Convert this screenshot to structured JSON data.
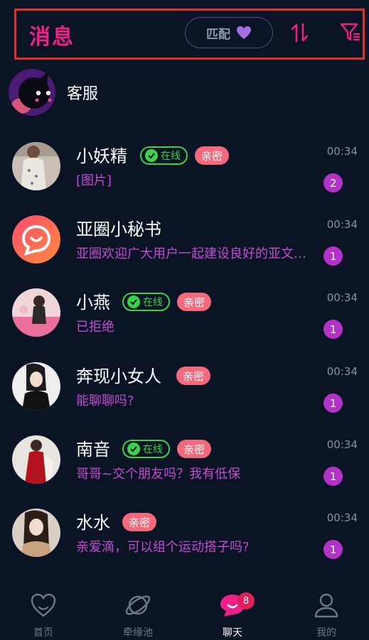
{
  "header": {
    "title": "消息",
    "match_label": "匹配"
  },
  "service": {
    "name": "客服"
  },
  "conversations": [
    {
      "name": "小妖精",
      "online": true,
      "online_label": "在线",
      "intimate_label": "亲密",
      "preview": "[图片]",
      "time": "00:34",
      "unread": "2"
    },
    {
      "name": "亚圈小秘书",
      "online": false,
      "online_label": "",
      "intimate_label": "",
      "preview": "亚圈欢迎广大用户一起建设良好的亚文…",
      "time": "00:34",
      "unread": "1"
    },
    {
      "name": "小燕",
      "online": true,
      "online_label": "在线",
      "intimate_label": "亲密",
      "preview": "已拒绝",
      "time": "00:34",
      "unread": "1"
    },
    {
      "name": "奔现小女人",
      "online": false,
      "online_label": "",
      "intimate_label": "亲密",
      "preview": "能聊聊吗?",
      "time": "00:34",
      "unread": "1"
    },
    {
      "name": "南音",
      "online": true,
      "online_label": "在线",
      "intimate_label": "亲密",
      "preview": "哥哥~交个朋友吗？我有低保",
      "time": "00:34",
      "unread": "1"
    },
    {
      "name": "水水",
      "online": false,
      "online_label": "",
      "intimate_label": "亲密",
      "preview": "亲爱滴，可以组个运动搭子吗?",
      "time": "00:34",
      "unread": "1"
    }
  ],
  "nav": {
    "home": "首页",
    "pool": "牵缘池",
    "chat": "聊天",
    "chat_badge": "8",
    "mine": "我的"
  },
  "colors": {
    "background": "#0b1424",
    "accent_pink": "#f0208a",
    "preview_purple": "#c24dd1",
    "online_green": "#3bd14a",
    "intimate_red": "#f26a7b",
    "unread_purple": "#b432c8"
  }
}
